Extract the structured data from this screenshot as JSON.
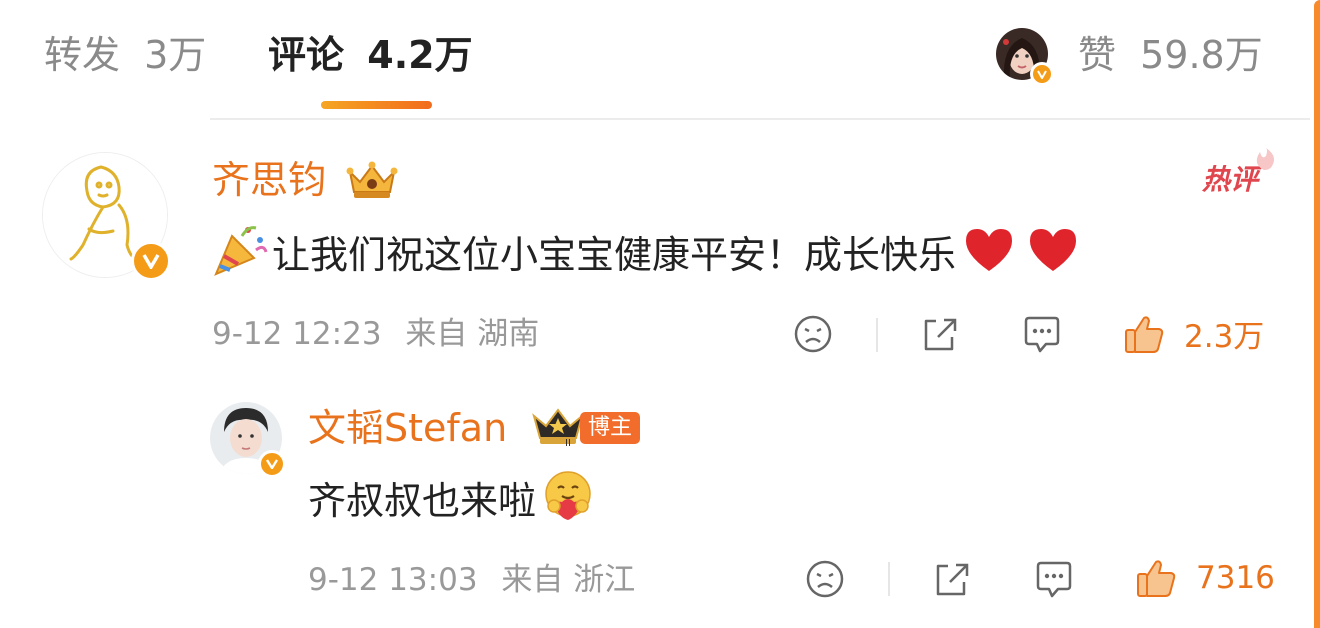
{
  "tabs": {
    "repost": {
      "label": "转发",
      "count": "3万"
    },
    "comment": {
      "label": "评论",
      "count": "4.2万"
    },
    "like": {
      "label": "赞",
      "count": "59.8万"
    }
  },
  "comments": [
    {
      "author": "齐思钧",
      "hot_label": "热评",
      "text": "让我们祝这位小宝宝健康平安！成长快乐",
      "time": "9-12 12:23",
      "source": "来自 湖南",
      "likes": "2.3万",
      "emoji_prefix": "party-popper",
      "emoji_suffix": [
        "red-heart",
        "red-heart"
      ]
    },
    {
      "author": "文韬Stefan",
      "blogger_label": "博主",
      "text": "齐叔叔也来啦",
      "time": "9-12 13:03",
      "source": "来自 浙江",
      "likes": "7316",
      "emoji_suffix": [
        "hugging-face"
      ]
    }
  ],
  "colors": {
    "accent_orange": "#e8731c",
    "hot_red": "#e0464e",
    "verified": "#f49b18",
    "text_main": "#222222",
    "text_meta": "#999999"
  }
}
